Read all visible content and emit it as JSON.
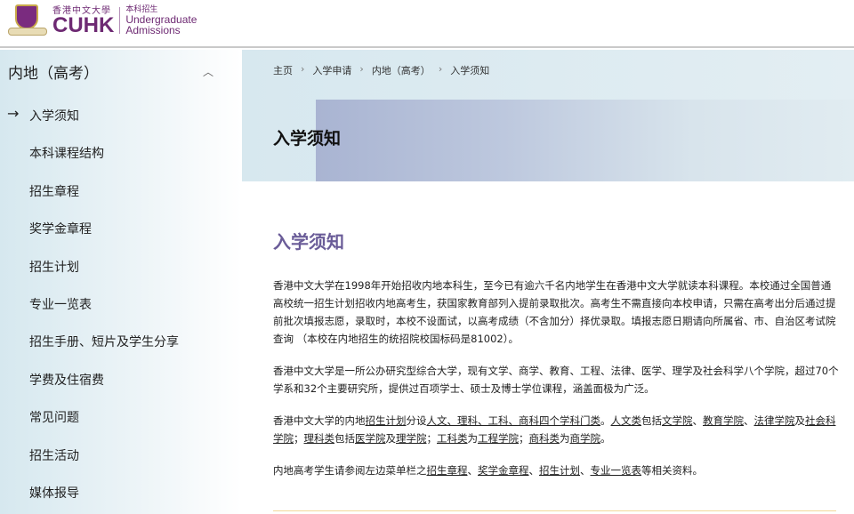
{
  "header": {
    "logo_cn": "香港中文大學",
    "logo_en": "CUHK",
    "unit_cn": "本科招生",
    "unit_en_1": "Undergraduate",
    "unit_en_2": "Admissions"
  },
  "sidebar": {
    "title": "内地（高考）",
    "active_arrow": "→",
    "items": [
      {
        "label": "入学须知"
      },
      {
        "label": "本科课程结构"
      },
      {
        "label": "招生章程"
      },
      {
        "label": "奖学金章程"
      },
      {
        "label": "招生计划"
      },
      {
        "label": "专业一览表"
      },
      {
        "label": "招生手册、短片及学生分享"
      },
      {
        "label": "学费及住宿费"
      },
      {
        "label": "常见问题"
      },
      {
        "label": "招生活动"
      },
      {
        "label": "媒体报导"
      }
    ]
  },
  "breadcrumb": [
    "主页",
    "入学申请",
    "内地（高考）",
    "入学须知"
  ],
  "banner": {
    "title": "入学须知"
  },
  "main": {
    "heading": "入学须知",
    "p1": "香港中文大学在1998年开始招收内地本科生，至今已有逾六千名内地学生在香港中文大学就读本科课程。本校通过全国普通高校统一招生计划招收内地高考生，获国家教育部列入提前录取批次。高考生不需直接向本校申请，只需在高考出分后通过提前批次填报志愿，录取时，本校不设面试，以高考成绩（不含加分）择优录取。填报志愿日期请向所属省、市、自治区考试院查询 （本校在内地招生的统招院校国标码是81002）。",
    "p2": "香港中文大学是一所公办研究型综合大学，现有文学、商学、教育、工程、法律、医学、理学及社会科学八个学院，超过70个学系和32个主要研究所，提供过百项学士、硕士及博士学位课程，涵盖面极为广泛。",
    "p3": [
      {
        "t": "香港中文大学的内地"
      },
      {
        "t": "招生计划",
        "link": true
      },
      {
        "t": "分设"
      },
      {
        "t": "人文、理科、工科、商科四个学科门类",
        "link": true
      },
      {
        "t": "。"
      },
      {
        "t": "人文类",
        "link": true
      },
      {
        "t": "包括"
      },
      {
        "t": "文学院",
        "link": true
      },
      {
        "t": "、"
      },
      {
        "t": "教育学院",
        "link": true
      },
      {
        "t": "、"
      },
      {
        "t": "法律学院",
        "link": true
      },
      {
        "t": "及"
      },
      {
        "t": "社会科学院",
        "link": true
      },
      {
        "t": "；"
      },
      {
        "t": "理科类",
        "link": true
      },
      {
        "t": "包括"
      },
      {
        "t": "医学院",
        "link": true
      },
      {
        "t": "及"
      },
      {
        "t": "理学院",
        "link": true
      },
      {
        "t": "；"
      },
      {
        "t": "工科类",
        "link": true
      },
      {
        "t": "为"
      },
      {
        "t": "工程学院",
        "link": true
      },
      {
        "t": "；"
      },
      {
        "t": "商科类",
        "link": true
      },
      {
        "t": "为"
      },
      {
        "t": "商学院",
        "link": true
      },
      {
        "t": "。"
      }
    ],
    "p4": [
      {
        "t": "内地高考学生请参阅左边菜单栏之"
      },
      {
        "t": "招生章程",
        "link": true
      },
      {
        "t": "、"
      },
      {
        "t": "奖学金章程",
        "link": true
      },
      {
        "t": "、"
      },
      {
        "t": "招生计划",
        "link": true
      },
      {
        "t": "、"
      },
      {
        "t": "专业一览表",
        "link": true
      },
      {
        "t": "等相关资料。"
      }
    ]
  }
}
